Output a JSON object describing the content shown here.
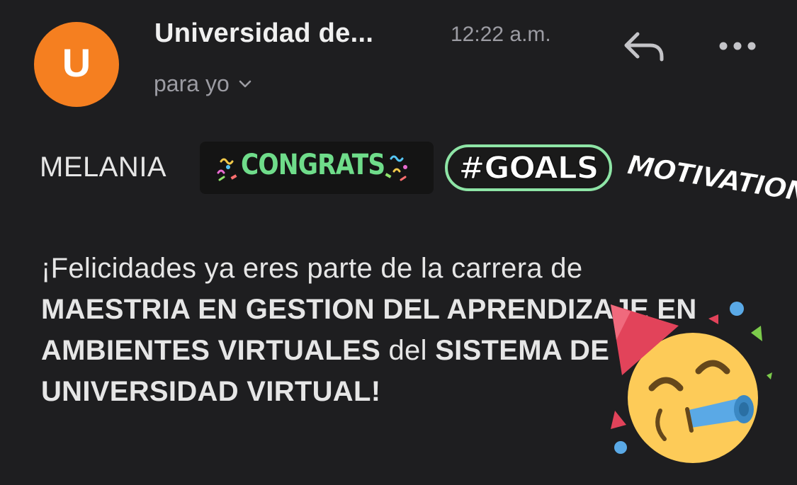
{
  "header": {
    "avatar_letter": "U",
    "avatar_color": "#f57f20",
    "sender": "Universidad de...",
    "time": "12:22 a.m.",
    "recipient": "para yo",
    "reply_icon": "reply-icon",
    "more_icon": "more-horizontal-icon",
    "recipient_icon": "chevron-down-icon"
  },
  "body": {
    "greeting_name": "MELANIA",
    "stickers": {
      "congrats": "CONGRATS",
      "goals": "#GOALS",
      "motivation": "MOTIVATION"
    },
    "message": {
      "line_intro": "¡Felicidades ya eres parte de la carrera de",
      "program": "MAESTRIA EN GESTION DEL APRENDIZAJE EN AMBIENTES VIRTUALES",
      "connector": "del",
      "system": "SISTEMA DE UNIVERSIDAD VIRTUAL!"
    },
    "emoji": "partying-face"
  },
  "colors": {
    "background": "#1e1e20",
    "text_primary": "#e6e6e6",
    "text_secondary": "#9c9ca3",
    "congrats_green": "#6fdc8a",
    "goals_border": "#8ee5a6",
    "emoji_yellow": "#fdcb58"
  }
}
